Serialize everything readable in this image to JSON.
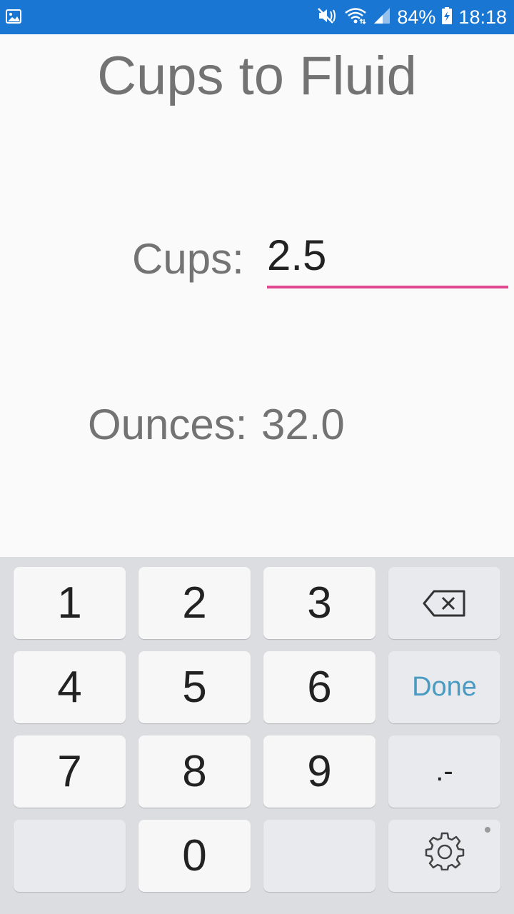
{
  "status_bar": {
    "battery_percent": "84%",
    "time": "18:18",
    "icons": [
      "gallery-icon",
      "mute-icon",
      "wifi-icon",
      "signal-icon",
      "battery-charging-icon"
    ]
  },
  "app": {
    "title": "Cups to Fluid"
  },
  "form": {
    "cups_label": "Cups:",
    "cups_value": "2.5",
    "ounces_label": "Ounces:",
    "ounces_value": "32.0"
  },
  "keyboard": {
    "keys": {
      "k1": "1",
      "k2": "2",
      "k3": "3",
      "k4": "4",
      "k5": "5",
      "k6": "6",
      "k7": "7",
      "k8": "8",
      "k9": "9",
      "k0": "0",
      "done": "Done",
      "symbol": ".-"
    },
    "icons": [
      "backspace-icon",
      "settings-icon"
    ]
  },
  "colors": {
    "status_bar": "#1976d2",
    "underline_accent": "#e2488f",
    "done_key_text": "#4a9bc3",
    "label_text": "#737373"
  }
}
